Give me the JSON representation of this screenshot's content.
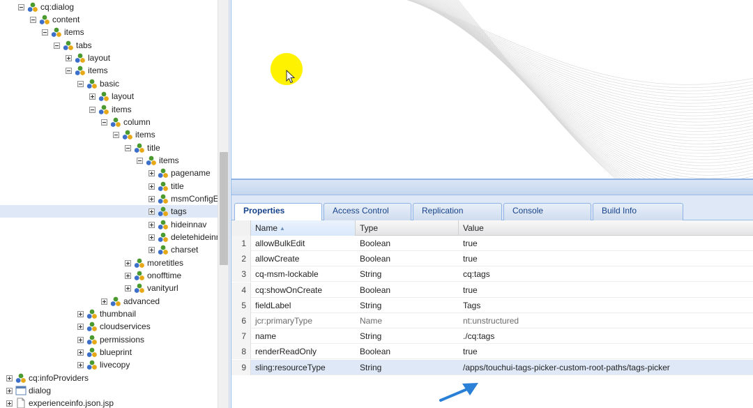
{
  "tree": {
    "nodes": [
      {
        "label": "cq:dialog",
        "icon": "node-icon",
        "state": "expanded"
      },
      {
        "label": "content",
        "icon": "node-icon",
        "state": "expanded"
      },
      {
        "label": "items",
        "icon": "node-icon",
        "state": "expanded"
      },
      {
        "label": "tabs",
        "icon": "node-icon",
        "state": "expanded"
      },
      {
        "label": "layout",
        "icon": "node-icon",
        "state": "collapsed"
      },
      {
        "label": "items",
        "icon": "node-icon",
        "state": "expanded"
      },
      {
        "label": "basic",
        "icon": "node-icon",
        "state": "expanded"
      },
      {
        "label": "layout",
        "icon": "node-icon",
        "state": "collapsed"
      },
      {
        "label": "items",
        "icon": "node-icon",
        "state": "expanded"
      },
      {
        "label": "column",
        "icon": "node-icon",
        "state": "expanded"
      },
      {
        "label": "items",
        "icon": "node-icon",
        "state": "expanded"
      },
      {
        "label": "title",
        "icon": "node-icon",
        "state": "expanded"
      },
      {
        "label": "items",
        "icon": "node-icon",
        "state": "expanded"
      },
      {
        "label": "pagename",
        "icon": "node-icon",
        "state": "collapsed"
      },
      {
        "label": "title",
        "icon": "node-icon",
        "state": "collapsed"
      },
      {
        "label": "msmConfigEr",
        "icon": "node-icon",
        "state": "collapsed"
      },
      {
        "label": "tags",
        "icon": "node-icon",
        "state": "collapsed",
        "selected": true
      },
      {
        "label": "hideinnav",
        "icon": "node-icon",
        "state": "collapsed"
      },
      {
        "label": "deletehideinn",
        "icon": "node-icon",
        "state": "collapsed"
      },
      {
        "label": "charset",
        "icon": "node-icon",
        "state": "collapsed"
      },
      {
        "label": "moretitles",
        "icon": "node-icon",
        "state": "collapsed"
      },
      {
        "label": "onofftime",
        "icon": "node-icon",
        "state": "collapsed"
      },
      {
        "label": "vanityurl",
        "icon": "node-icon",
        "state": "collapsed"
      },
      {
        "label": "advanced",
        "icon": "node-icon",
        "state": "collapsed"
      },
      {
        "label": "thumbnail",
        "icon": "node-icon",
        "state": "collapsed"
      },
      {
        "label": "cloudservices",
        "icon": "node-icon",
        "state": "collapsed"
      },
      {
        "label": "permissions",
        "icon": "node-icon",
        "state": "collapsed"
      },
      {
        "label": "blueprint",
        "icon": "node-icon",
        "state": "collapsed"
      },
      {
        "label": "livecopy",
        "icon": "node-icon",
        "state": "collapsed"
      },
      {
        "label": "cq:infoProviders",
        "icon": "node-icon",
        "state": "collapsed"
      },
      {
        "label": "dialog",
        "icon": "dialog-icon",
        "state": "collapsed"
      },
      {
        "label": "experienceinfo.json.jsp",
        "icon": "file-icon",
        "state": "collapsed"
      }
    ]
  },
  "tabs": [
    {
      "label": "Properties",
      "active": true
    },
    {
      "label": "Access Control"
    },
    {
      "label": "Replication"
    },
    {
      "label": "Console"
    },
    {
      "label": "Build Info"
    }
  ],
  "grid": {
    "columns": {
      "name": "Name",
      "type": "Type",
      "value": "Value"
    },
    "rows": [
      {
        "num": "1",
        "name": "allowBulkEdit",
        "type": "Boolean",
        "value": "true"
      },
      {
        "num": "2",
        "name": "allowCreate",
        "type": "Boolean",
        "value": "true"
      },
      {
        "num": "3",
        "name": "cq-msm-lockable",
        "type": "String",
        "value": "cq:tags"
      },
      {
        "num": "4",
        "name": "cq:showOnCreate",
        "type": "Boolean",
        "value": "true"
      },
      {
        "num": "5",
        "name": "fieldLabel",
        "type": "String",
        "value": "Tags"
      },
      {
        "num": "6",
        "name": "jcr:primaryType",
        "type": "Name",
        "value": "nt:unstructured",
        "muted": true
      },
      {
        "num": "7",
        "name": "name",
        "type": "String",
        "value": "./cq:tags"
      },
      {
        "num": "8",
        "name": "renderReadOnly",
        "type": "Boolean",
        "value": "true"
      },
      {
        "num": "9",
        "name": "sling:resourceType",
        "type": "String",
        "value": "/apps/touchui-tags-picker-custom-root-paths/tags-picker",
        "selected": true
      }
    ]
  },
  "colors": {
    "selection": "#dfe8f6",
    "tab_text": "#15428b",
    "cursor_highlight": "#fff200",
    "annotation_arrow": "#2a7fd6"
  }
}
